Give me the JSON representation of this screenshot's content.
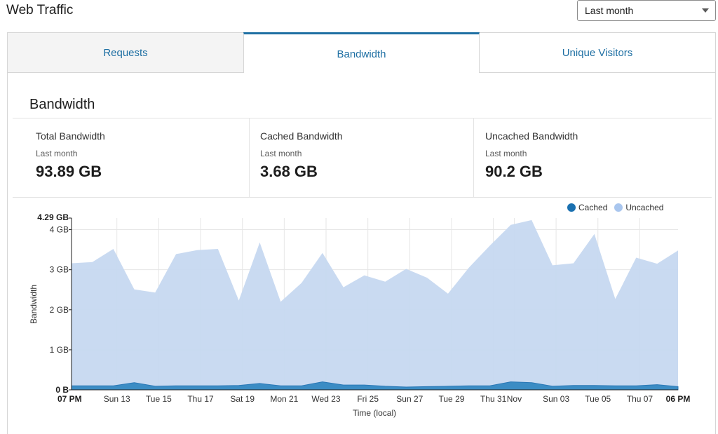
{
  "header": {
    "title": "Web Traffic",
    "range_value": "Last month"
  },
  "tabs": [
    {
      "label": "Requests"
    },
    {
      "label": "Bandwidth"
    },
    {
      "label": "Unique Visitors"
    }
  ],
  "panel": {
    "title": "Bandwidth",
    "stats": [
      {
        "label": "Total Bandwidth",
        "sub": "Last month",
        "value": "93.89 GB"
      },
      {
        "label": "Cached Bandwidth",
        "sub": "Last month",
        "value": "3.68 GB"
      },
      {
        "label": "Uncached Bandwidth",
        "sub": "Last month",
        "value": "90.2 GB"
      }
    ]
  },
  "colors": {
    "accent": "#1e6fa3",
    "cached": "#3b8cc4",
    "cached_dark": "#1a70b0",
    "uncached": "#c6d8f0",
    "uncached_dot": "#a9c6ee"
  },
  "chart_data": {
    "type": "area",
    "stacked": true,
    "ylabel": "Bandwidth",
    "xlabel": "Time (local)",
    "y_max_label": "4.29 GB",
    "y_ticks": [
      "0 B",
      "1 GB",
      "2 GB",
      "3 GB",
      "4 GB"
    ],
    "y_tick_values": [
      0,
      1,
      2,
      3,
      4
    ],
    "ylim": [
      0,
      4.29
    ],
    "x_labels": [
      "07 PM",
      "Sun 13",
      "Tue 15",
      "Thu 17",
      "Sat 19",
      "Mon 21",
      "Wed 23",
      "Fri 25",
      "Sun 27",
      "Tue 29",
      "Thu 31",
      "Nov",
      "Sun 03",
      "Tue 05",
      "Thu 07",
      "06 PM"
    ],
    "x_label_positions": [
      0,
      2.17,
      4.17,
      6.17,
      8.17,
      10.17,
      12.17,
      14.17,
      16.17,
      18.17,
      20.17,
      21.17,
      23.17,
      25.17,
      27.17,
      29
    ],
    "x_bold_labels": [
      "07 PM",
      "06 PM"
    ],
    "grid": true,
    "legend_position": "top-right",
    "x": [
      0,
      1,
      2,
      3,
      4,
      5,
      6,
      7,
      8,
      9,
      10,
      11,
      12,
      13,
      14,
      15,
      16,
      17,
      18,
      19,
      20,
      21,
      22,
      23,
      24,
      25,
      26,
      27,
      28,
      29
    ],
    "series": [
      {
        "name": "Cached",
        "values": [
          0.1,
          0.1,
          0.1,
          0.18,
          0.09,
          0.1,
          0.1,
          0.1,
          0.11,
          0.16,
          0.1,
          0.1,
          0.2,
          0.12,
          0.12,
          0.09,
          0.07,
          0.08,
          0.09,
          0.1,
          0.1,
          0.2,
          0.18,
          0.09,
          0.11,
          0.11,
          0.1,
          0.1,
          0.13,
          0.08
        ]
      },
      {
        "name": "Uncached",
        "values": [
          3.06,
          3.09,
          3.42,
          2.33,
          2.34,
          3.29,
          3.39,
          3.42,
          2.12,
          3.52,
          2.1,
          2.57,
          3.22,
          2.44,
          2.74,
          2.61,
          2.95,
          2.72,
          2.31,
          2.95,
          3.5,
          3.92,
          4.06,
          3.02,
          3.05,
          3.78,
          2.17,
          3.2,
          3.02,
          3.4
        ]
      }
    ]
  }
}
